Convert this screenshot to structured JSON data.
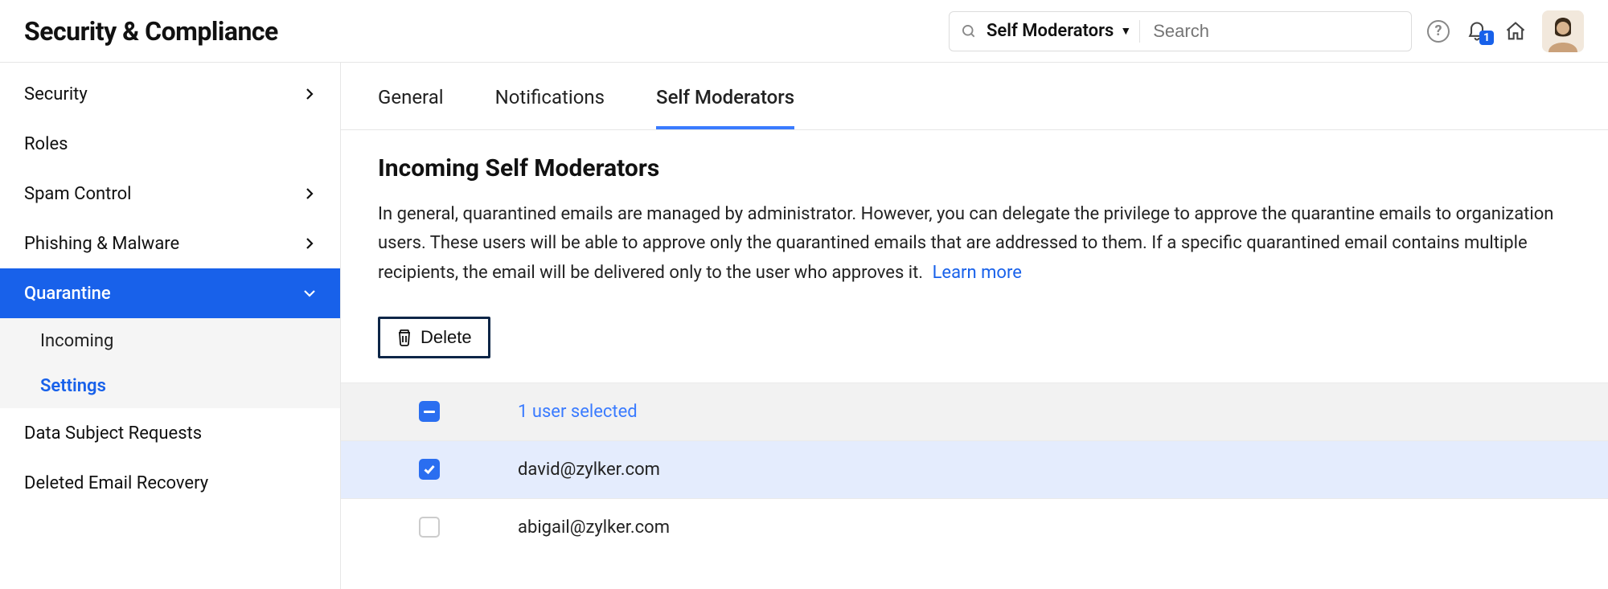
{
  "header": {
    "title": "Security & Compliance",
    "search_scope": "Self Moderators",
    "search_placeholder": "Search",
    "notif_count": "1"
  },
  "sidebar": {
    "items": [
      {
        "label": "Security",
        "chevron": true
      },
      {
        "label": "Roles",
        "chevron": false
      },
      {
        "label": "Spam Control",
        "chevron": true
      },
      {
        "label": "Phishing & Malware",
        "chevron": true
      },
      {
        "label": "Quarantine",
        "chevron": "down",
        "active": true
      },
      {
        "label": "Data Subject Requests",
        "chevron": false
      },
      {
        "label": "Deleted Email Recovery",
        "chevron": false
      }
    ],
    "quarantine_sub": [
      {
        "label": "Incoming",
        "active": false
      },
      {
        "label": "Settings",
        "active": true
      }
    ]
  },
  "tabs": [
    {
      "label": "General",
      "active": false
    },
    {
      "label": "Notifications",
      "active": false
    },
    {
      "label": "Self Moderators",
      "active": true
    }
  ],
  "section": {
    "title": "Incoming Self Moderators",
    "description": "In general, quarantined emails are managed by administrator. However, you can delegate the privilege to approve the quarantine emails to organization users. These users will be able to approve only the quarantined emails that are addressed to them. If a specific quarantined email contains multiple recipients, the email will be delivered only to the user who approves it. ",
    "learn_more": "Learn more",
    "delete_label": "Delete",
    "selection_text": "1 user selected",
    "rows": [
      {
        "email": "david@zylker.com",
        "checked": true
      },
      {
        "email": "abigail@zylker.com",
        "checked": false
      }
    ]
  }
}
